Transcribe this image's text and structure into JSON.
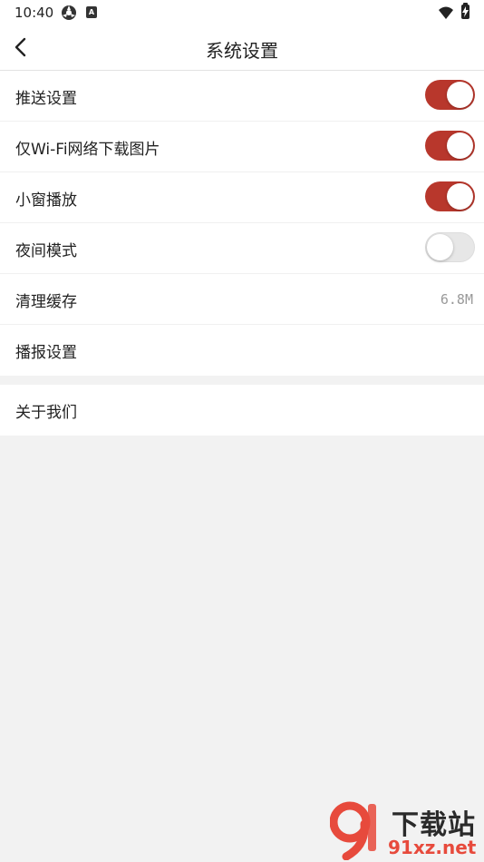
{
  "status_bar": {
    "time": "10:40",
    "a_badge": "A"
  },
  "header": {
    "title": "系统设置"
  },
  "settings": {
    "group1": [
      {
        "label": "推送设置",
        "toggle": true
      },
      {
        "label": "仅Wi-Fi网络下载图片",
        "toggle": true
      },
      {
        "label": "小窗播放",
        "toggle": true
      },
      {
        "label": "夜间模式",
        "toggle": false
      },
      {
        "label": "清理缓存",
        "value": "6.8M"
      },
      {
        "label": "播报设置"
      }
    ],
    "group2": [
      {
        "label": "关于我们"
      }
    ]
  },
  "watermark": {
    "top_text": "下载站",
    "bottom_text": "91xz.net"
  },
  "colors": {
    "accent": "#b8372c",
    "toggle_off": "#e7e7e7",
    "background": "#f2f2f2"
  }
}
